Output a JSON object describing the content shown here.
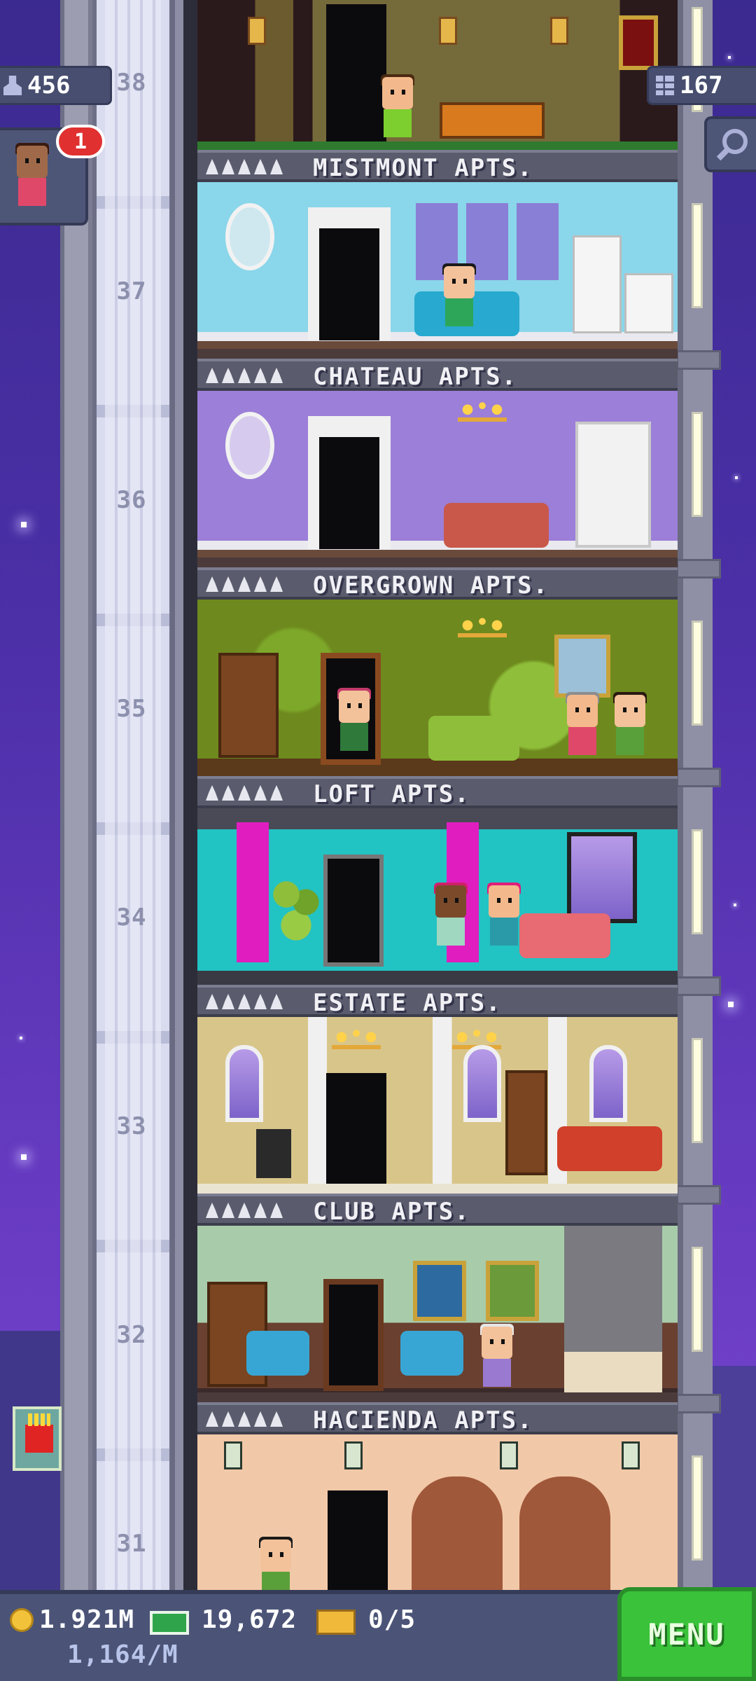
{
  "hud": {
    "population": "456",
    "floors_built": "167",
    "notification_count": "1"
  },
  "floors": [
    {
      "number": "38",
      "name": "MISTMONT APTS.",
      "stars": 5
    },
    {
      "number": "37",
      "name": "CHATEAU APTS.",
      "stars": 5
    },
    {
      "number": "36",
      "name": "OVERGROWN APTS.",
      "stars": 5
    },
    {
      "number": "35",
      "name": "LOFT APTS.",
      "stars": 5
    },
    {
      "number": "34",
      "name": "ESTATE APTS.",
      "stars": 5
    },
    {
      "number": "33",
      "name": "CLUB APTS.",
      "stars": 5
    },
    {
      "number": "32",
      "name": "HACIENDA APTS.",
      "stars": 5
    },
    {
      "number": "31",
      "name": "",
      "stars": 0
    }
  ],
  "bottom_bar": {
    "coins": "1.921M",
    "coins_rate": "1,164/M",
    "tower_bux": "19,672",
    "tickets": "0/5",
    "menu_label": "MENU"
  },
  "colors": {
    "sky": "#4a2fa6",
    "menu_green": "#39c23a",
    "hud_panel": "#474e6f",
    "badge_red": "#e03030"
  },
  "icons": [
    "population-icon",
    "floors-icon",
    "search-icon",
    "coin-icon",
    "bux-icon",
    "ticket-icon",
    "star-icon",
    "fries-icon"
  ]
}
